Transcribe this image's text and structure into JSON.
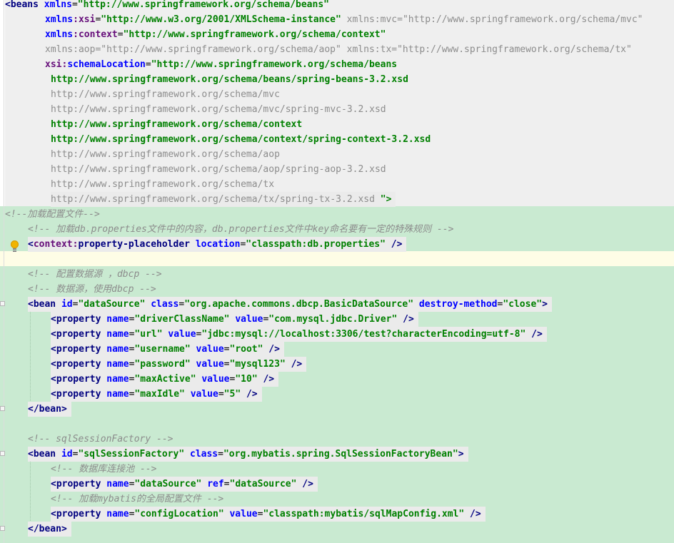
{
  "editor": {
    "language": "XML",
    "file_type": "spring applicationContext xml",
    "colors": {
      "tag": "#000080",
      "attribute": "#0000ff",
      "namespace": "#660e7a",
      "value": "#008000",
      "comment": "#8c8c8c",
      "unused": "#8c8c8c",
      "green_highlight": "#c9ead1",
      "caret_line": "#fefde6"
    },
    "intention_icon": "lightbulb-icon",
    "tokens": {
      "lt": "<",
      "gt": ">",
      "self_close": " />",
      "end_gt": " \">",
      "eq": "=",
      "q": "\"",
      "colon": ":",
      "close_bean": "</bean>",
      "beans_tag": "beans",
      "bean_tag": "bean",
      "property_tag": "property",
      "xmlns": "xmlns",
      "xsi": "xsi",
      "schemaLocation": "schemaLocation",
      "context": "context",
      "property_placeholder": "property-placeholder",
      "location": "location",
      "id": "id",
      "class": "class",
      "destroy_method": "destroy-method",
      "name": "name",
      "value": "value",
      "ref": "ref"
    },
    "header": {
      "beans_ns": "http://www.springframework.org/schema/beans",
      "xsi_ns": "http://www.w3.org/2001/XMLSchema-instance",
      "mvc_decl": "xmlns:mvc=\"http://www.springframework.org/schema/mvc\"",
      "context_ns": "http://www.springframework.org/schema/context",
      "aop_decl": "xmlns:aop=\"http://www.springframework.org/schema/aop\"",
      "tx_decl": "xmlns:tx=\"http://www.springframework.org/schema/tx\"",
      "schema_beans": "http://www.springframework.org/schema/beans",
      "schema_lines": [
        "http://www.springframework.org/schema/beans/spring-beans-3.2.xsd",
        "http://www.springframework.org/schema/mvc",
        "http://www.springframework.org/schema/mvc/spring-mvc-3.2.xsd",
        "http://www.springframework.org/schema/context",
        "http://www.springframework.org/schema/context/spring-context-3.2.xsd",
        "http://www.springframework.org/schema/aop",
        "http://www.springframework.org/schema/aop/spring-aop-3.2.xsd",
        "http://www.springframework.org/schema/tx"
      ],
      "schema_last": "http://www.springframework.org/schema/tx/spring-tx-3.2.xsd"
    },
    "comments": {
      "load_config": "<!--加载配置文件-->",
      "load_db_props": "<!-- 加载db.properties文件中的内容，db.properties文件中key命名要有一定的特殊规则 -->",
      "config_ds": "<!-- 配置数据源 ，dbcp -->",
      "ds_use_dbcp": "<!-- 数据源，使用dbcp -->",
      "ssf": "<!-- sqlSessionFactory -->",
      "pool": "<!-- 数据库连接池 -->",
      "mybatis_global": "<!-- 加载mybatis的全局配置文件 -->"
    },
    "placeholder_location": "classpath:db.properties",
    "datasource": {
      "id": "dataSource",
      "class": "org.apache.commons.dbcp.BasicDataSource",
      "destroy_method": "close",
      "properties": [
        {
          "name": "driverClassName",
          "value": "com.mysql.jdbc.Driver"
        },
        {
          "name": "url",
          "value": "jdbc:mysql://localhost:3306/test?characterEncoding=utf-8"
        },
        {
          "name": "username",
          "value": "root"
        },
        {
          "name": "password",
          "value": "mysql123"
        },
        {
          "name": "maxActive",
          "value": "10"
        },
        {
          "name": "maxIdle",
          "value": "5"
        }
      ]
    },
    "ssf": {
      "id": "sqlSessionFactory",
      "class": "org.mybatis.spring.SqlSessionFactoryBean",
      "ds_prop_name": "dataSource",
      "ds_prop_ref": "dataSource",
      "config_prop_name": "configLocation",
      "config_prop_value": "classpath:mybatis/sqlMapConfig.xml"
    }
  }
}
